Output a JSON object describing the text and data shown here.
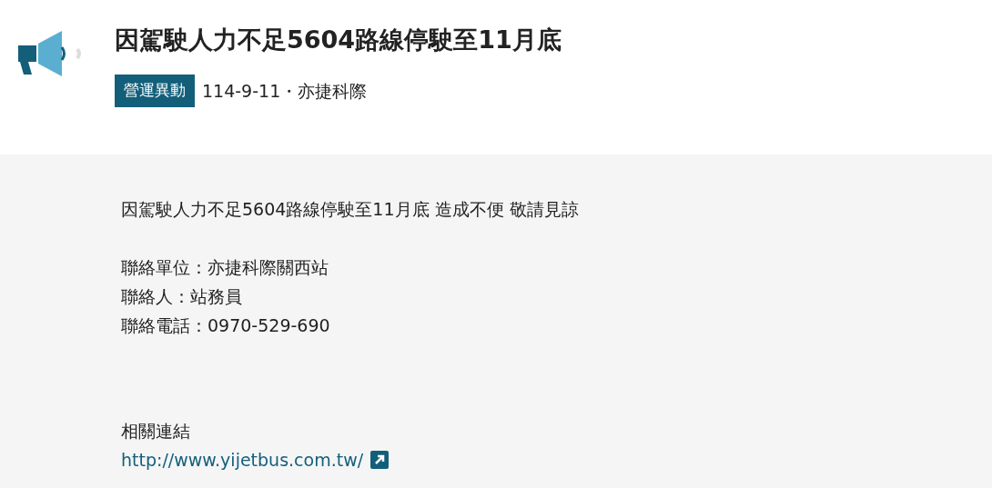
{
  "header": {
    "title": "因駕駛人力不足5604路線停駛至11月底",
    "category": "營運異動",
    "meta": "114-9-11・亦捷科際"
  },
  "body": {
    "summary": "因駕駛人力不足5604路線停駛至11月底 造成不便 敬請見諒",
    "contacts": [
      "聯絡單位：亦捷科際關西站",
      "聯絡人：站務員",
      "聯絡電話：0970-529-690"
    ]
  },
  "links": {
    "heading": "相關連結",
    "items": [
      {
        "url": "http://www.yijetbus.com.tw/",
        "external": true
      }
    ]
  }
}
